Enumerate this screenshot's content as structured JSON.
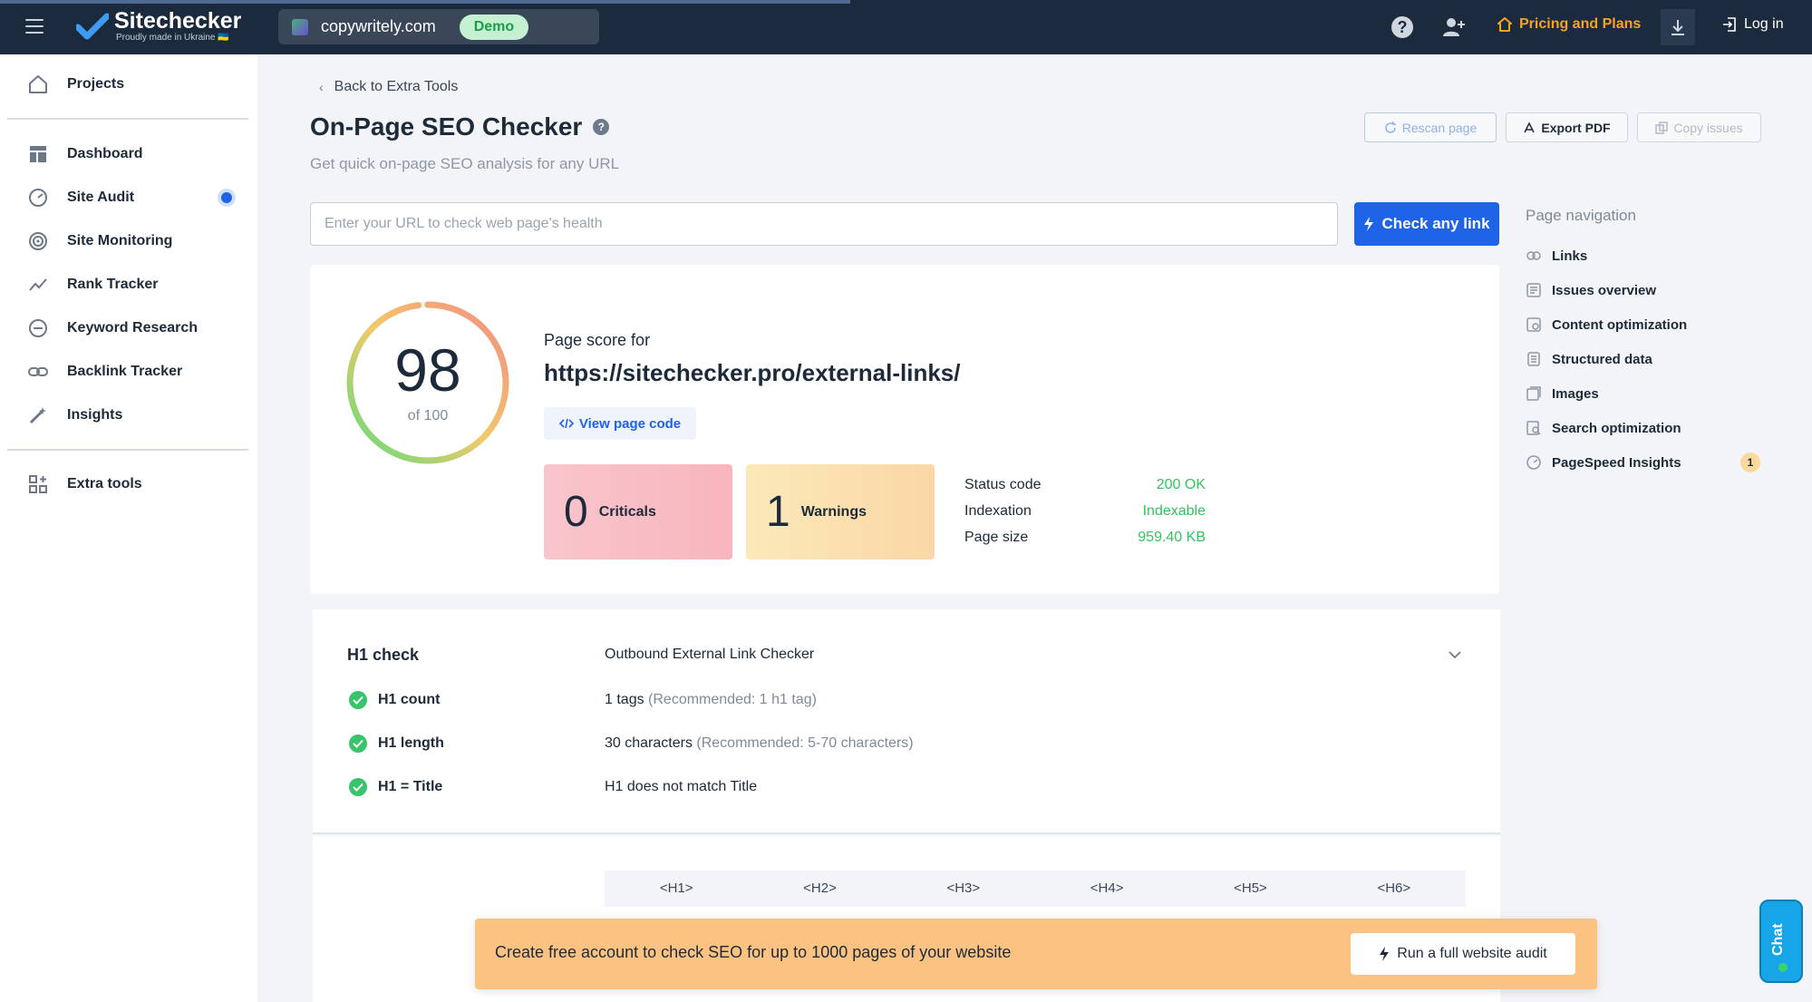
{
  "topbar": {
    "logo_title": "Sitechecker",
    "logo_sub": "Proudly made in Ukraine 🇺🇦",
    "project_name": "copywritely.com",
    "demo_label": "Demo",
    "pricing_label": "Pricing and Plans",
    "login_label": "Log in"
  },
  "sidebar": {
    "items": [
      {
        "label": "Projects",
        "icon": "home-icon"
      },
      {
        "label": "Dashboard",
        "icon": "dashboard-icon"
      },
      {
        "label": "Site Audit",
        "icon": "gauge-icon"
      },
      {
        "label": "Site Monitoring",
        "icon": "monitoring-icon"
      },
      {
        "label": "Rank Tracker",
        "icon": "trend-icon"
      },
      {
        "label": "Keyword Research",
        "icon": "keyword-icon"
      },
      {
        "label": "Backlink Tracker",
        "icon": "link-icon"
      },
      {
        "label": "Insights",
        "icon": "wand-icon"
      },
      {
        "label": "Extra tools",
        "icon": "grid-plus-icon"
      }
    ]
  },
  "main": {
    "back_label": "Back to Extra Tools",
    "title": "On-Page SEO Checker",
    "subtitle": "Get quick on-page SEO analysis for any URL",
    "buttons": {
      "rescan": "Rescan page",
      "export": "Export PDF",
      "copy": "Copy issues"
    },
    "url_input": {
      "value": "",
      "placeholder": "Enter your URL to check web page's health"
    },
    "check_button": "Check any link"
  },
  "score": {
    "value": "98",
    "of_label": "of 100",
    "fraction": 0.98,
    "label": "Page score for",
    "url": "https://sitechecker.pro/external-links/",
    "view_code": "View page code",
    "criticals_count": "0",
    "criticals_label": "Criticals",
    "warnings_count": "1",
    "warnings_label": "Warnings",
    "stats": [
      {
        "key": "Status code",
        "value": "200 OK"
      },
      {
        "key": "Indexation",
        "value": "Indexable"
      },
      {
        "key": "Page size",
        "value": "959.40 KB"
      }
    ]
  },
  "h1_check": {
    "title": "H1 check",
    "value": "Outbound External Link Checker",
    "rows": [
      {
        "name": "H1 count",
        "value": "1 tags",
        "rec": "(Recommended: 1 h1 tag)"
      },
      {
        "name": "H1 length",
        "value": "30 characters",
        "rec": "(Recommended: 5-70 characters)"
      },
      {
        "name": "H1 = Title",
        "value": "H1 does not match Title",
        "rec": ""
      }
    ]
  },
  "tags": {
    "headers": [
      "<H1>",
      "<H2>",
      "<H3>",
      "<H4>",
      "<H5>",
      "<H6>"
    ]
  },
  "banner": {
    "text": "Create free account to check SEO for up to 1000 pages of your website",
    "button": "Run a full website audit"
  },
  "page_nav": {
    "title": "Page navigation",
    "items": [
      {
        "label": "Links",
        "icon": "link-icon"
      },
      {
        "label": "Issues overview",
        "icon": "issues-icon"
      },
      {
        "label": "Content optimization",
        "icon": "content-icon"
      },
      {
        "label": "Structured data",
        "icon": "structured-icon"
      },
      {
        "label": "Images",
        "icon": "image-icon"
      },
      {
        "label": "Search optimization",
        "icon": "search-doc-icon"
      },
      {
        "label": "PageSpeed Insights",
        "icon": "speed-icon",
        "badge": "1"
      }
    ]
  },
  "chat": {
    "label": "Chat"
  },
  "colors": {
    "topbar": "#1c2a3d",
    "accent": "#1f63e6",
    "pricing": "#f6a227",
    "ok": "#32c35e",
    "banner": "#fcc281"
  }
}
